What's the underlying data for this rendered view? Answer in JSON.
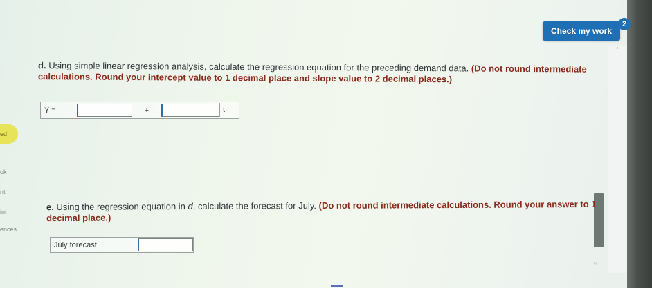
{
  "header": {
    "check_button_label": "Check my work",
    "check_count": "2"
  },
  "sidebar": {
    "items": [
      {
        "label": "ed"
      },
      {
        "label": "ok"
      },
      {
        "label": "nt"
      },
      {
        "label": "int"
      },
      {
        "label": "ences"
      }
    ]
  },
  "question_d": {
    "label": "d.",
    "text": "Using simple linear regression analysis, calculate the regression equation for the preceding demand data.",
    "note": "(Do not round intermediate calculations. Round your intercept value to 1 decimal place and slope value to 2 decimal places.)",
    "equation_label": "Y =",
    "plus_sign": "+",
    "variable": "t",
    "intercept_value": "",
    "slope_value": ""
  },
  "question_e": {
    "label": "e.",
    "text_before": "Using the regression equation in",
    "ref_letter": "d",
    "text_after": ", calculate the forecast for July.",
    "note": "(Do not round intermediate calculations. Round your answer to 1 decimal place.)",
    "forecast_label": "July forecast",
    "forecast_value": ""
  },
  "icons": {
    "scroll_up": "chevron-up-icon",
    "scroll_down": "chevron-down-icon"
  },
  "colors": {
    "accent": "#1f6fb5",
    "note": "#8a2a1a",
    "badge": "#e8e45a"
  }
}
